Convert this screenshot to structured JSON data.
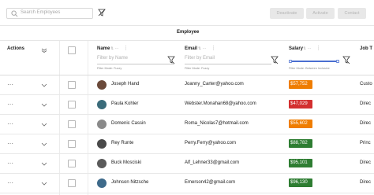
{
  "toolbar": {
    "search_placeholder": "Search Employees",
    "deactivate_label": "Deactivate",
    "activate_label": "Activate",
    "contact_label": "Contact"
  },
  "group_header": {
    "label": "Employee"
  },
  "columns": {
    "actions": "Actions",
    "name": "Name",
    "email": "Email",
    "salary": "Salary",
    "job": "Job T"
  },
  "filters": {
    "name_placeholder": "Filter by Name",
    "name_mode": "Filter Mode: Fuzzy",
    "email_placeholder": "Filter by Email",
    "email_mode": "Filter Mode: Fuzzy",
    "salary_mode": "Filter Mode: Between Inclusive",
    "salary_range_fraction": [
      0.0,
      1.0
    ]
  },
  "colors": {
    "orange": "#ef7d00",
    "red": "#d32f2f",
    "green": "#2e7d32",
    "slider": "#4a6fd1"
  },
  "rows": [
    {
      "name": "Joseph Hand",
      "email": "Joanny_Carter@yahoo.com",
      "salary": "$57,752",
      "salary_color": "#ef7d00",
      "job": "Custo"
    },
    {
      "name": "Paula Kohler",
      "email": "Webster.Monahan68@yahoo.com",
      "salary": "$47,029",
      "salary_color": "#d32f2f",
      "job": "Direc"
    },
    {
      "name": "Domenic Cassin",
      "email": "Roma_Nicolas7@hotmail.com",
      "salary": "$55,602",
      "salary_color": "#ef7d00",
      "job": "Direc"
    },
    {
      "name": "Rey Runte",
      "email": "Perry.Ferry@yahoo.com",
      "salary": "$88,782",
      "salary_color": "#2e7d32",
      "job": "Princ"
    },
    {
      "name": "Buck Mosciski",
      "email": "Alf_Lehner33@gmail.com",
      "salary": "$95,101",
      "salary_color": "#2e7d32",
      "job": "Direc"
    },
    {
      "name": "Johnson Nitzsche",
      "email": "Emerson42@gmail.com",
      "salary": "$96,130",
      "salary_color": "#2e7d32",
      "job": "Direc"
    }
  ]
}
